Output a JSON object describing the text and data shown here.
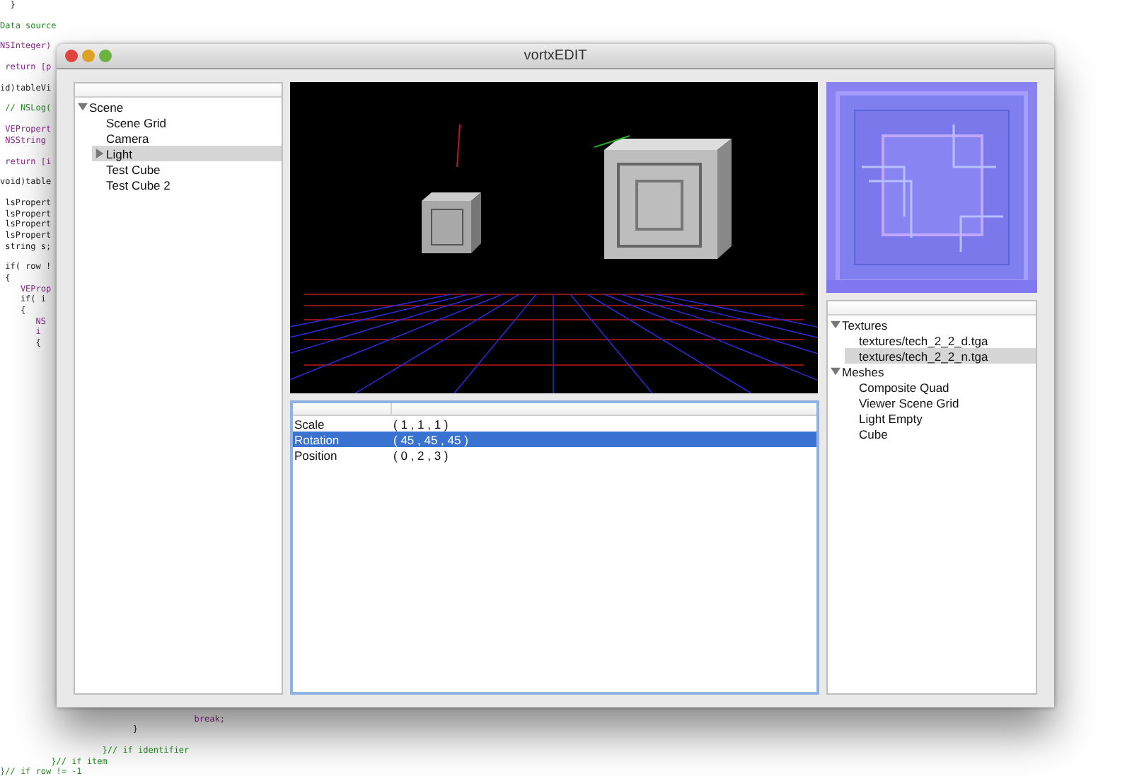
{
  "editor": {
    "upper": [
      {
        "lines": [
          {
            "text": "  }",
            "kind": "plain"
          }
        ]
      },
      {
        "lines": [
          {
            "text": "Data source",
            "kind": "comment"
          }
        ]
      },
      {
        "lines": [
          {
            "text": "NSInteger)",
            "kind": "keyword"
          }
        ]
      },
      {
        "lines": [
          {
            "text": " return [p",
            "kind": "keyword"
          }
        ]
      },
      {
        "lines": [
          {
            "text": "id)tableVi",
            "kind": "plain"
          }
        ]
      },
      {
        "lines": [
          {
            "text": " // NSLog(",
            "kind": "comment"
          }
        ]
      },
      {
        "lines": [
          {
            "text": " VEPropert",
            "kind": "keyword"
          },
          {
            "text": " NSString",
            "kind": "keyword"
          }
        ]
      },
      {
        "lines": [
          {
            "text": " return [i",
            "kind": "keyword"
          }
        ]
      },
      {
        "lines": [
          {
            "text": "void)table",
            "kind": "plain"
          }
        ]
      },
      {
        "lines": [
          {
            "text": " lsPropert",
            "kind": "plain"
          },
          {
            "text": " lsPropert",
            "kind": "plain"
          },
          {
            "text": " lsPropert",
            "kind": "plain"
          },
          {
            "text": " lsPropert",
            "kind": "plain"
          },
          {
            "text": " string s;",
            "kind": "plain"
          }
        ]
      },
      {
        "lines": [
          {
            "text": " if( row !",
            "kind": "plain"
          },
          {
            "text": " {",
            "kind": "plain"
          },
          {
            "text": "    VEProp",
            "kind": "keyword"
          },
          {
            "text": "    if( i",
            "kind": "plain"
          },
          {
            "text": "    {",
            "kind": "plain"
          },
          {
            "text": "       NS",
            "kind": "keyword"
          },
          {
            "text": "       i",
            "kind": "keyword"
          },
          {
            "text": "       {",
            "kind": "plain"
          }
        ]
      }
    ],
    "lower": [
      {
        "lines": [
          {
            "text": "                                      break;",
            "kind": "keyword"
          },
          {
            "text": "                          }",
            "kind": "plain"
          }
        ]
      },
      {
        "lines": [
          {
            "text": "                    }// if identifier",
            "kind": "comment"
          },
          {
            "text": "          }// if item",
            "kind": "comment"
          },
          {
            "text": "}// if row != -1",
            "kind": "comment"
          }
        ]
      }
    ]
  },
  "window": {
    "title": "vortxEDIT",
    "scene_tree": [
      {
        "label": "Scene",
        "expanded": true,
        "selected": false,
        "children": [
          {
            "label": "Scene Grid",
            "selected": false
          },
          {
            "label": "Camera",
            "selected": false
          },
          {
            "label": "Light",
            "expanded": false,
            "selected": true
          },
          {
            "label": "Test Cube",
            "selected": false
          },
          {
            "label": "Test Cube 2",
            "selected": false
          }
        ]
      }
    ],
    "properties": {
      "rows": [
        {
          "name": "Scale",
          "value": "( 1 , 1 , 1 )",
          "selected": false
        },
        {
          "name": "Rotation",
          "value": "( 45 , 45 , 45 )",
          "selected": true
        },
        {
          "name": "Position",
          "value": "( 0 , 2 , 3 )",
          "selected": false
        }
      ]
    },
    "asset_tree": [
      {
        "label": "Textures",
        "expanded": true,
        "selected": false,
        "children": [
          {
            "label": "textures/tech_2_2_d.tga",
            "selected": false
          },
          {
            "label": "textures/tech_2_2_n.tga",
            "selected": true
          }
        ]
      },
      {
        "label": "Meshes",
        "expanded": true,
        "selected": false,
        "children": [
          {
            "label": "Composite Quad",
            "selected": false
          },
          {
            "label": "Viewer Scene Grid",
            "selected": false
          },
          {
            "label": "Light Empty",
            "selected": false
          },
          {
            "label": "Cube",
            "selected": false
          }
        ]
      }
    ]
  }
}
